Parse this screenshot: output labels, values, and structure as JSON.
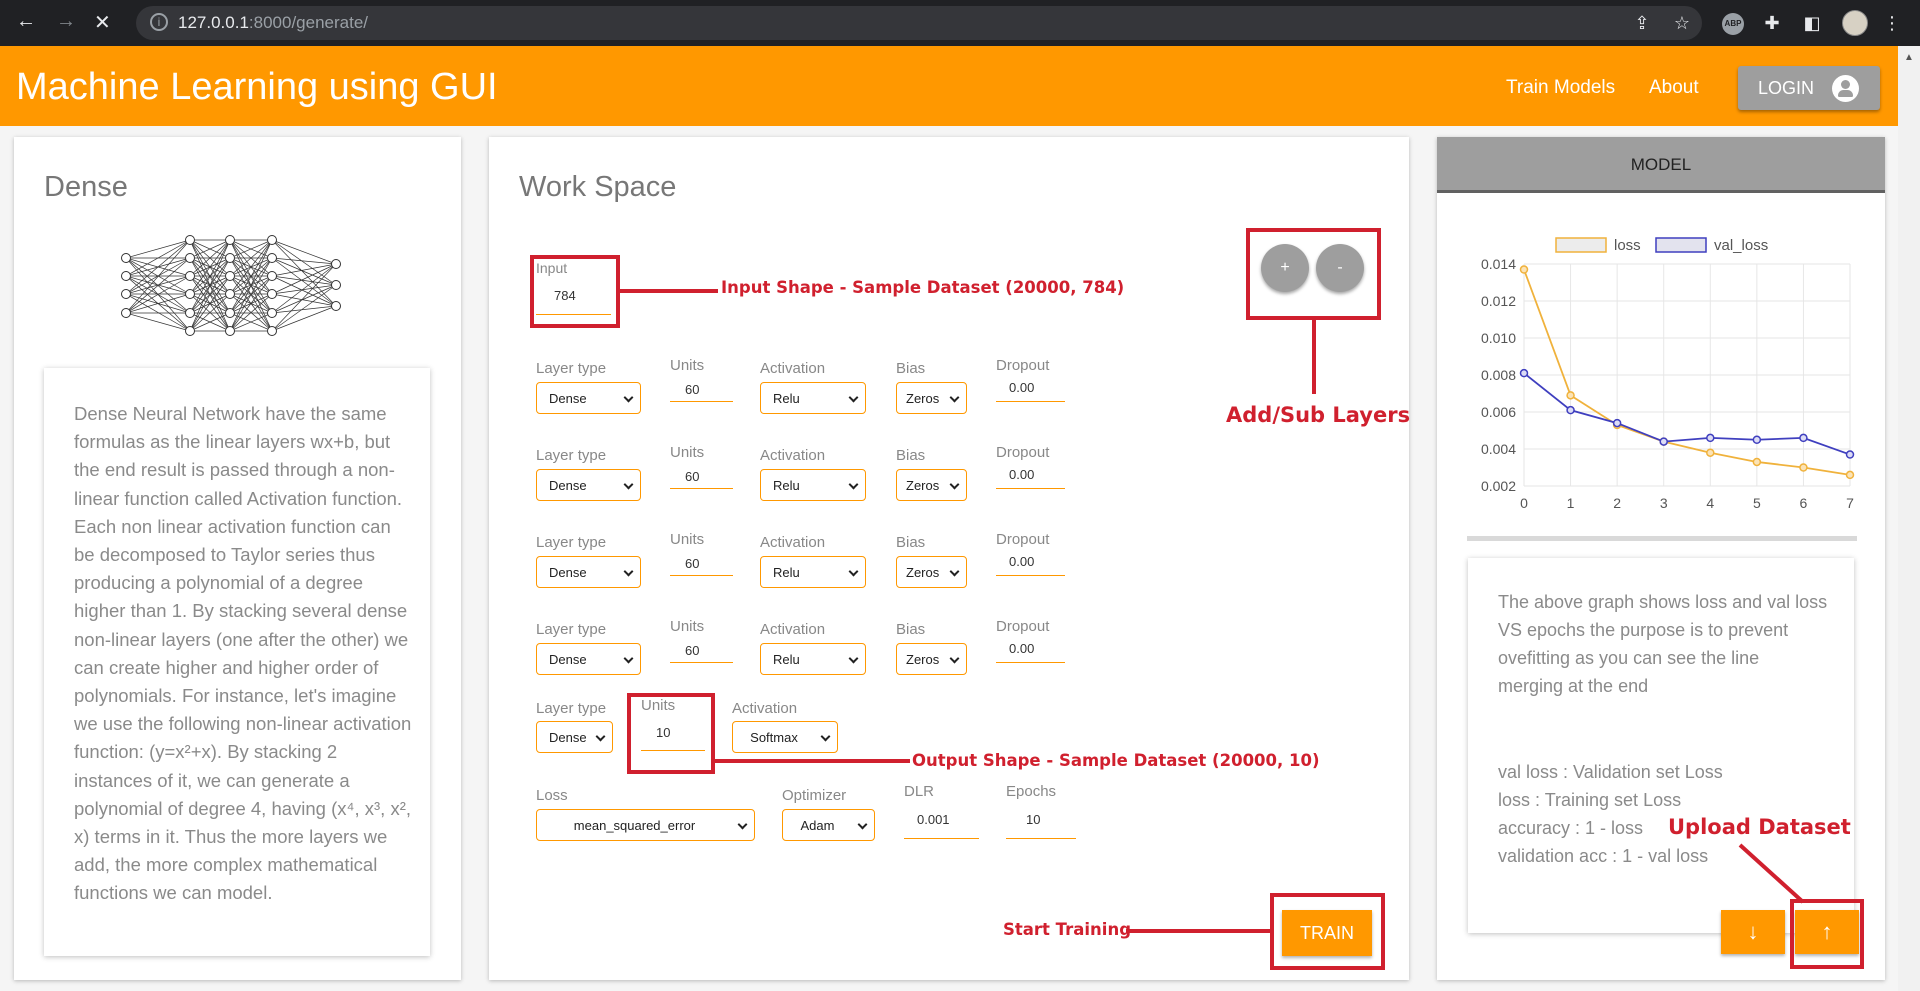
{
  "browser": {
    "url_host": "127.0.0.1",
    "url_rest": ":8000/generate/"
  },
  "header": {
    "title": "Machine Learning using GUI",
    "nav": [
      "Train Models",
      "About"
    ],
    "login_label": "LOGIN"
  },
  "left": {
    "title": "Dense",
    "description": "Dense Neural Network have the same formulas as the linear layers wx+b, but the end result is passed through a non-linear function called Activation function. Each non linear activation function can be decomposed to Taylor series thus producing a polynomial of a degree higher than 1. By stacking several dense non-linear layers (one after the other) we can create higher and higher order of polynomials. For instance, let's imagine we use the following non-linear activation function: (y=x²+x). By stacking 2 instances of it, we can generate a polynomial of degree 4, having (x⁴, x³, x², x) terms in it. Thus the more layers we add, the more complex mathematical functions we can model."
  },
  "workspace": {
    "title": "Work Space",
    "input": {
      "label": "Input",
      "value": "784"
    },
    "labels": {
      "layer_type": "Layer type",
      "units": "Units",
      "activation": "Activation",
      "bias": "Bias",
      "dropout": "Dropout"
    },
    "layers": [
      {
        "type": "Dense",
        "units": "60",
        "activation": "Relu",
        "bias": "Zeros",
        "dropout": "0.00"
      },
      {
        "type": "Dense",
        "units": "60",
        "activation": "Relu",
        "bias": "Zeros",
        "dropout": "0.00"
      },
      {
        "type": "Dense",
        "units": "60",
        "activation": "Relu",
        "bias": "Zeros",
        "dropout": "0.00"
      },
      {
        "type": "Dense",
        "units": "60",
        "activation": "Relu",
        "bias": "Zeros",
        "dropout": "0.00"
      }
    ],
    "output": {
      "type": "Dense",
      "units": "10",
      "activation": "Softmax"
    },
    "compile": {
      "loss_label": "Loss",
      "loss": "mean_squared_error",
      "optimizer_label": "Optimizer",
      "optimizer": "Adam",
      "lr_label": "DLR",
      "lr": "0.001",
      "epochs_label": "Epochs",
      "epochs": "10"
    },
    "add_label": "+",
    "sub_label": "-",
    "train_label": "TRAIN"
  },
  "annotations": {
    "input_shape": "Input Shape - Sample Dataset (20000, 784)",
    "add_sub": "Add/Sub Layers",
    "output_shape": "Output Shape - Sample Dataset (20000, 10)",
    "start_training": "Start Training",
    "upload_dataset": "Upload Dataset"
  },
  "model": {
    "tab_label": "MODEL",
    "info_lines": [
      "The above graph shows loss and val loss VS epochs the purpose is to prevent ovefitting as you can see the line merging at the end",
      "val loss : Validation set Loss",
      "loss : Training set Loss",
      "accuracy : 1 - loss",
      "validation acc : 1 - val loss"
    ],
    "download_icon": "arrow-down-icon",
    "upload_icon": "arrow-up-icon"
  },
  "chart_data": {
    "type": "line",
    "x": [
      0,
      1,
      2,
      3,
      4,
      5,
      6,
      7
    ],
    "series": [
      {
        "name": "loss",
        "values": [
          0.0137,
          0.0069,
          0.0053,
          0.0044,
          0.0038,
          0.0033,
          0.003,
          0.0026
        ],
        "color": "#f0b23c"
      },
      {
        "name": "val_loss",
        "values": [
          0.0081,
          0.0061,
          0.0054,
          0.0044,
          0.0046,
          0.0045,
          0.0046,
          0.0037
        ],
        "color": "#3f3fbf"
      }
    ],
    "yticks": [
      "0.014",
      "0.012",
      "0.010",
      "0.008",
      "0.006",
      "0.004",
      "0.002"
    ],
    "xticks": [
      "0",
      "1",
      "2",
      "3",
      "4",
      "5",
      "6",
      "7"
    ],
    "ylim": [
      0.002,
      0.014
    ],
    "xlim": [
      0,
      7
    ],
    "legend_position": "top",
    "grid": true
  }
}
